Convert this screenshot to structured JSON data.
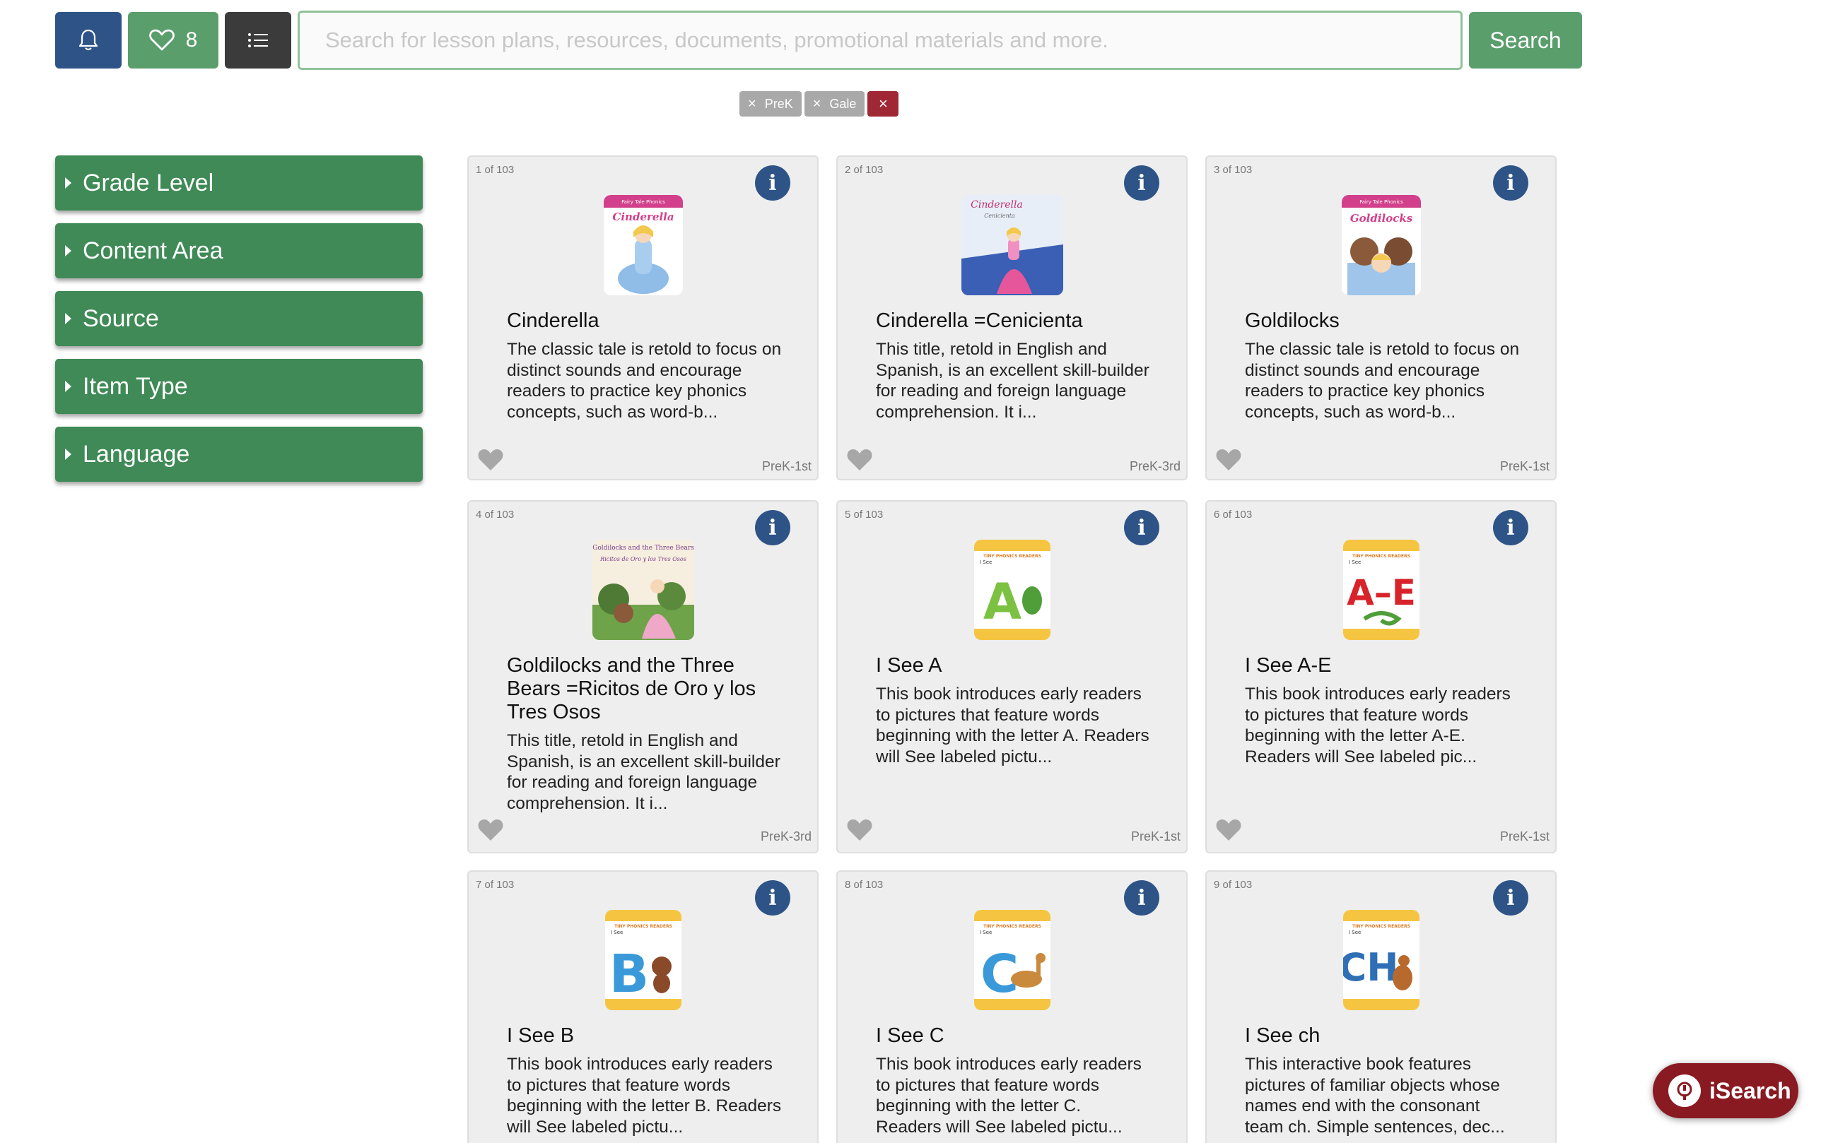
{
  "toolbar": {
    "bell_icon": "bell-icon",
    "favorites_count": "8",
    "search_placeholder": "Search for lesson plans, resources, documents, promotional materials and more.",
    "search_label": "Search"
  },
  "filters": {
    "chips": [
      {
        "label": "PreK"
      },
      {
        "label": "Gale"
      }
    ],
    "clear_label": "×"
  },
  "sidebar": {
    "facets": [
      {
        "label": "Grade Level"
      },
      {
        "label": "Content Area"
      },
      {
        "label": "Source"
      },
      {
        "label": "Item Type"
      },
      {
        "label": "Language"
      }
    ]
  },
  "results": [
    {
      "count": "1 of 103",
      "title": "Cinderella",
      "desc": "The classic tale is retold to focus on distinct sounds and encourage readers to practice key phonics concepts, such as word-b...",
      "grade": "PreK-1st"
    },
    {
      "count": "2 of 103",
      "title": "Cinderella =Cenicienta",
      "desc": "This title, retold in English and Spanish, is an excellent skill-builder for reading and foreign language comprehension. It i...",
      "grade": "PreK-3rd"
    },
    {
      "count": "3 of 103",
      "title": "Goldilocks",
      "desc": "The classic tale is retold to focus on distinct sounds and encourage readers to practice key phonics concepts, such as word-b...",
      "grade": "PreK-1st"
    },
    {
      "count": "4 of 103",
      "title": "Goldilocks and the Three Bears =Ricitos de Oro y los Tres Osos",
      "desc": "This title, retold in English and Spanish, is an excellent skill-builder for reading and foreign language comprehension. It i...",
      "grade": "PreK-3rd"
    },
    {
      "count": "5 of 103",
      "title": "I See A",
      "desc": "This book introduces early readers to pictures that feature words beginning with the letter A. Readers will See labeled pictu...",
      "grade": "PreK-1st"
    },
    {
      "count": "6 of 103",
      "title": "I See A-E",
      "desc": "This book introduces early readers to pictures that feature words beginning with the letter A-E. Readers will See labeled pic...",
      "grade": "PreK-1st"
    },
    {
      "count": "7 of 103",
      "title": "I See B",
      "desc": "This book introduces early readers to pictures that feature words beginning with the letter B. Readers will See labeled pictu...",
      "grade": ""
    },
    {
      "count": "8 of 103",
      "title": "I See C",
      "desc": "This book introduces early readers to pictures that feature words beginning with the letter C. Readers will See labeled pictu...",
      "grade": ""
    },
    {
      "count": "9 of 103",
      "title": "I See ch",
      "desc": "This interactive book features pictures of familiar objects whose names end with the consonant team ch. Simple sentences, dec...",
      "grade": ""
    }
  ],
  "covers": {
    "cinderella": {
      "banner": "Fairy Tale Phonics",
      "title": "Cinderella"
    },
    "cenicienta": {
      "title": "Cinderella",
      "subtitle": "Cenicienta"
    },
    "goldilocks": {
      "banner": "Fairy Tale Phonics",
      "title": "Goldilocks"
    },
    "ricitos": {
      "title": "Goldilocks and the Three Bears",
      "subtitle": "Ricitos de Oro y los Tres Osos"
    },
    "isee_a": {
      "banner": "TINY PHONICS READERS",
      "kicker": "I See",
      "letter": "A",
      "color": "#7cc142"
    },
    "isee_ae": {
      "banner": "TINY PHONICS READERS",
      "kicker": "I See",
      "letter": "A–E",
      "color": "#d8232a"
    },
    "isee_b": {
      "banner": "TINY PHONICS READERS",
      "kicker": "I See",
      "letter": "B",
      "color": "#3a9ad9"
    },
    "isee_c": {
      "banner": "TINY PHONICS READERS",
      "kicker": "I See",
      "letter": "C",
      "color": "#3a9ad9"
    },
    "isee_ch": {
      "banner": "TINY PHONICS READERS",
      "kicker": "I See",
      "letter": "CH",
      "color": "#2e6fb5"
    }
  },
  "colors": {
    "brand_green": "#5a9e6b",
    "facet_green": "#3f8a56",
    "navy": "#2e5487",
    "clear_red": "#a02835",
    "isearch_red": "#8a1a22"
  },
  "isearch": {
    "label": "iSearch"
  }
}
